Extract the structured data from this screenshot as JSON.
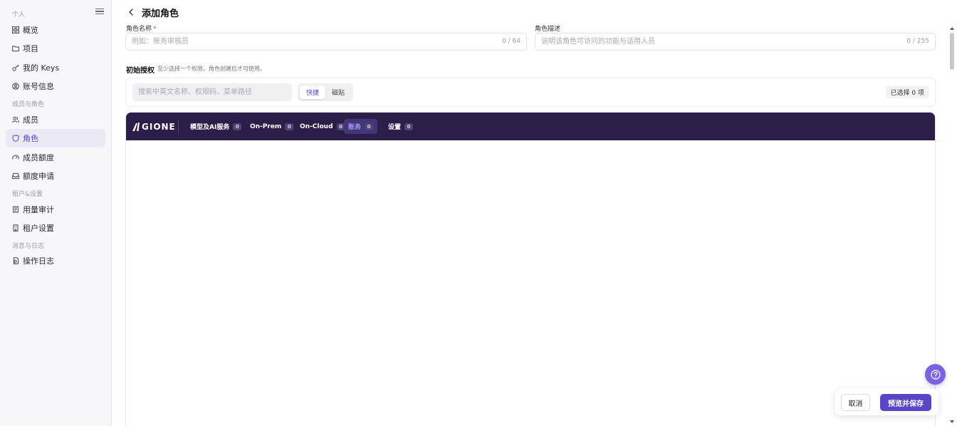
{
  "sidebar": {
    "section_personal": "个人",
    "section_members": "成员与角色",
    "section_tenant": "租户&设置",
    "section_logs": "消息与日志",
    "items": [
      {
        "label": "概览"
      },
      {
        "label": "项目"
      },
      {
        "label": "我的 Keys"
      },
      {
        "label": "账号信息"
      },
      {
        "label": "成员"
      },
      {
        "label": "角色"
      },
      {
        "label": "成员额度"
      },
      {
        "label": "额度申请"
      },
      {
        "label": "用量审计"
      },
      {
        "label": "租户设置"
      },
      {
        "label": "操作日志"
      }
    ],
    "active_item": "角色"
  },
  "header": {
    "title": "添加角色"
  },
  "form": {
    "name_label": "角色名称",
    "name_required": "*",
    "name_placeholder": "例如：账务审核员",
    "name_value": "",
    "name_counter": "0 / 64",
    "desc_label": "角色描述",
    "desc_placeholder": "说明该角色可访问的功能与适用人员",
    "desc_value": "",
    "desc_counter": "0 / 255"
  },
  "permissions": {
    "title": "初始授权",
    "hint": "至少选择一个权限，角色创建后才可使用。",
    "search_placeholder": "搜索中英文名称、权限码、菜单路径",
    "mode_quick": "快捷",
    "mode_paste": "磁贴",
    "active_mode": "快捷",
    "selected_count": "已选择 0 项"
  },
  "menu_bar": {
    "logo_text": "GIONE",
    "tabs": [
      {
        "label": "模型及AI服务",
        "count": "0"
      },
      {
        "label": "On-Prem",
        "count": "0"
      },
      {
        "label": "On-Cloud",
        "count": "0"
      },
      {
        "label": "账务",
        "count": "0"
      },
      {
        "label": "设置",
        "count": "0"
      }
    ],
    "active_tab": "账务"
  },
  "footer": {
    "cancel_label": "取消",
    "save_label": "预览并保存"
  },
  "colors": {
    "accent": "#5b46c8",
    "menu_bar_bg": "#2b1f4a",
    "sidebar_active_bg": "#ece9f7"
  },
  "icons": {
    "overview": "grid-icon",
    "projects": "folder-icon",
    "keys": "key-icon",
    "account": "user-circle-icon",
    "members": "users-icon",
    "roles": "shield-icon",
    "quota": "gauge-icon",
    "quota_request": "inbox-icon",
    "usage_audit": "scroll-icon",
    "tenant_settings": "building-icon",
    "operation_logs": "log-icon",
    "help": "question-icon"
  }
}
